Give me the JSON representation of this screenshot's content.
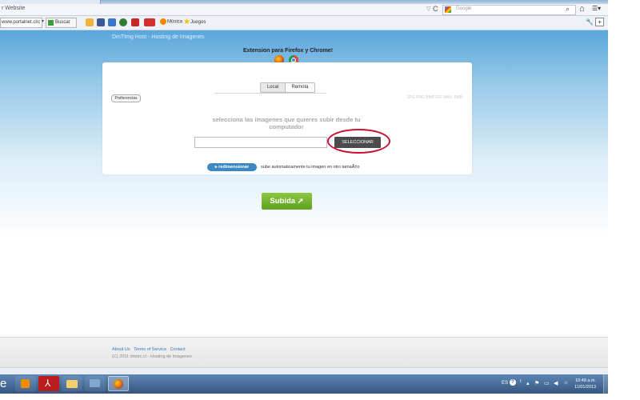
{
  "browser": {
    "url_text": "r Website",
    "search_placeholder": "Google",
    "url_arrow_glyph": "▽",
    "reload_glyph": "C",
    "search_glyph": "⌕",
    "home_glyph": "⌂",
    "menu_glyph": "☰▾"
  },
  "toolbar": {
    "input_value": "www.portalnet.cl/c",
    "buscar_label": "Buscar",
    "musica_label": "Música",
    "juegos_label": "Juegos",
    "drop_glyph": "▾"
  },
  "page": {
    "site_title": "DmTImg Host - Hosting de Imagenes",
    "extension_text": "Extension para Firefox y Chrome!",
    "tab_local": "Local",
    "tab_remota": "Remota",
    "preferences_label": "Preferencias",
    "formats_text": "JPG PNG BMP GIF   MAX. 5MB",
    "instruction_line1": "selecciona las imagenes que quieres subir desde tu",
    "instruction_line2": "computador",
    "select_button_label": "SELECCIONAR",
    "resize_button_label": "▸ redimensionar",
    "resize_description": "sube automaticamente tu imagen en otro tamaÃ±o",
    "upload_button_label": "Subida ➚"
  },
  "footer": {
    "links": [
      "About Us",
      "Terms of Service",
      "Contact"
    ],
    "copyright": "(C) 2011 dmtirc.cl - Hosting de Imagenes"
  },
  "taskbar": {
    "start_glyph": "e",
    "pdf_glyph": "⅄",
    "language": "ES",
    "help_glyph": "?",
    "tray_glyphs": [
      "ᶠ",
      "▴",
      "⚑",
      "▭",
      "◀",
      "☼"
    ],
    "time": "10:48 a.m.",
    "date": "11/01/2013"
  },
  "colors": {
    "annotation": "#c8102e",
    "upload_green": "#6db32e",
    "resize_blue": "#3d87c2"
  }
}
